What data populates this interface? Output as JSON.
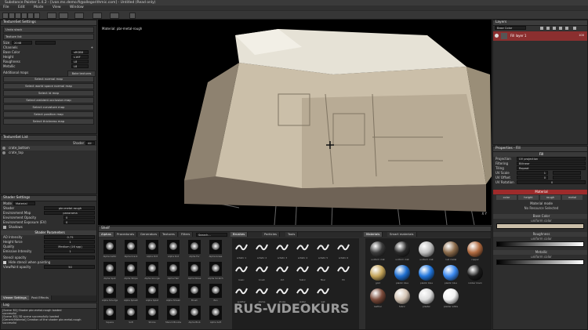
{
  "window": {
    "title": "Substance Painter 1.4.2 - [ivan.ms.demo.ft@allegorithmic.com] - Untitled (Read only)"
  },
  "menu": [
    "File",
    "Edit",
    "Mode",
    "View",
    "Window"
  ],
  "texture_set_settings": {
    "title": "TextureSet Settings",
    "uvdata_label": "Undo stack",
    "material_label": "Texture list",
    "size_label": "Size",
    "size_value": "2048",
    "channels_label": "Channels",
    "channels": [
      {
        "name": "Base Color",
        "format": "sRGB8"
      },
      {
        "name": "Height",
        "format": "L16F"
      },
      {
        "name": "Roughness",
        "format": "L8"
      },
      {
        "name": "Metallic",
        "format": "L8"
      }
    ],
    "additional_maps_label": "Additional maps",
    "bake_button": "Bake textures",
    "map_buttons": [
      "Select normal map",
      "Select world space normal map",
      "Select id map",
      "Select ambient occlusion map",
      "Select curvature map",
      "Select position map",
      "Select thickness map"
    ]
  },
  "texture_set_list": {
    "title": "TextureSet List",
    "filter_label": "Shader",
    "filter_value": "All",
    "items": [
      "crate_bottom",
      "crate_top"
    ]
  },
  "shader_settings": {
    "title": "Shader Settings",
    "mode_label": "Mode",
    "mode_value": "Material",
    "shader_label": "Shader",
    "shader_value": "pbr-metal-rough",
    "env_map_label": "Environment Map",
    "env_map_value": "panorama",
    "env_opacity_label": "Environment Opacity",
    "env_opacity_value": "0",
    "env_exposure_label": "Environment Exposure (EV)",
    "env_exposure_value": "0",
    "shadows_label": "Shadows",
    "shader_params_title": "Shader Parameters",
    "ao_label": "AO Intensity",
    "ao_value": "0.75",
    "height_label": "Height force",
    "height_value": "1",
    "quality_label": "Quality",
    "quality_value": "Medium (16 spp)",
    "emissive_label": "Emissive Intensity",
    "emissive_value": "1",
    "stencil_label": "Stencil opacity",
    "hide_stencil_label": "Hide stencil when painting",
    "viewport_opacity_label": "ViewPaint opacity",
    "viewport_opacity_value": "50",
    "bottom_tabs": [
      "Viewer Settings",
      "Post Effects"
    ]
  },
  "log": {
    "title": "Log",
    "lines": [
      "[Scene 3D] Shader pbr-metal-rough loaded",
      "successful",
      "[Scene 3D] 3D scene successfully loaded",
      "[GenericMaterial] Creation of the shader pbr-metal-rough",
      "successful"
    ]
  },
  "viewport": {
    "label": "Material: pbr-metal-rough",
    "axis_label": "X Y"
  },
  "shelf": {
    "title": "Shelf",
    "tabs": [
      "Alphas",
      "Procedurals",
      "Generators",
      "Textures",
      "Filters"
    ],
    "search_placeholder": "Search...",
    "items": [
      "Alpha Celtic",
      "Alpha Crack",
      "Alpha Dirt",
      "Alpha Dot",
      "Alpha Fur",
      "Alpha Grass",
      "Alpha Spot",
      "Alpha Stripe",
      "Alpha Grunge",
      "Alpha Hair",
      "Alpha Noise",
      "Alpha Scratch",
      "Alpha Smudge",
      "Alpha Splash",
      "Alpha Splat",
      "Alpha Streak",
      "Brush",
      "Pen",
      "Square",
      "Soft",
      "Stroke",
      "Stencil Brushes",
      "Alpha Blob",
      "Alpha Soft"
    ],
    "brushes_tab": "Brushes",
    "particles_tab": "Particles",
    "tools_tab": "Tools",
    "brush_items": [
      "artistic 1",
      "artistic 2",
      "artistic 3",
      "artistic 4",
      "artistic 5",
      "artistic 6",
      "basic",
      "brush",
      "dirt",
      "fabric",
      "fiber",
      "fill",
      "splatter",
      "stamp",
      "stroke",
      "water",
      "wet"
    ],
    "materials_tab": "Materials",
    "smart_materials_tab": "Smart materials",
    "material_items": [
      "uniform mat",
      "uniform mat",
      "uniform mat",
      "rust metal",
      "copper",
      "gold",
      "plastic blue",
      "plastic blue",
      "plastic blue",
      "rubber black",
      "leather",
      "fabric",
      "plaster",
      "plaster white"
    ],
    "watermark": "RUS-VIDEOKURS"
  },
  "layers": {
    "title": "Layers",
    "channel_value": "Base Color",
    "items": [
      {
        "name": "Fill layer 1",
        "opacity": "100"
      }
    ]
  },
  "properties": {
    "title": "Properties - Fill",
    "fill_label": "Fill",
    "projection_label": "Projection",
    "projection_value": "UV projection",
    "filtering_label": "Filtering",
    "filtering_value": "Bilinear",
    "tiling_label": "Tiling",
    "tiling_value": "Repeat",
    "uv_scale_label": "UV Scale",
    "uv_scale_value": "1",
    "uv_offset_label": "UV Offset",
    "uv_offset_value": "0",
    "uv_rotation_label": "UV Rotation",
    "uv_rotation_value": "0",
    "material_title": "Material",
    "material_channels": [
      "color",
      "height",
      "rough",
      "metal"
    ],
    "material_mode_label": "Material mode",
    "material_mode_value": "No Resource Selected",
    "base_color_label": "Base Color",
    "base_color_sub": "uniform color",
    "roughness_label": "Roughness",
    "roughness_sub": "uniform color",
    "metallic_label": "Metallic",
    "metallic_sub": "uniform color"
  },
  "colors": {
    "accent_red": "#9e2b2b",
    "panel_bg": "#2e2e2e",
    "header_bg": "#3c3c3c"
  }
}
